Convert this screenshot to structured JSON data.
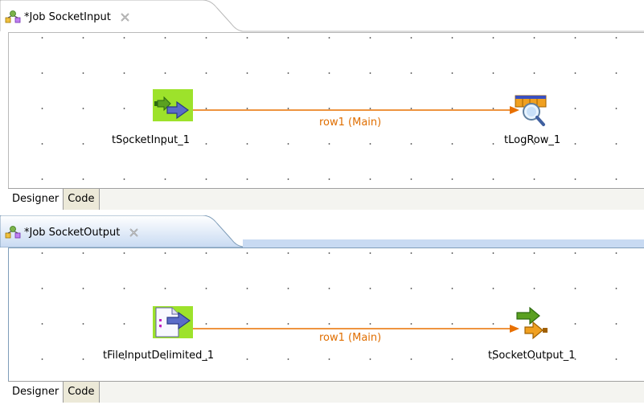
{
  "jobs": [
    {
      "tab_title": "*Job SocketInput",
      "subtabs": [
        "Designer",
        "Code"
      ],
      "source": {
        "label": "tSocketInput_1",
        "icon": "socket-input-icon"
      },
      "target": {
        "label": "tLogRow_1",
        "icon": "logrow-icon"
      },
      "link_label": "row1 (Main)"
    },
    {
      "tab_title": "*Job SocketOutput",
      "subtabs": [
        "Designer",
        "Code"
      ],
      "source": {
        "label": "tFileInputDelimited_1",
        "icon": "file-input-delimited-icon"
      },
      "target": {
        "label": "tSocketOutput_1",
        "icon": "socket-output-icon"
      },
      "link_label": "row1 (Main)"
    }
  ],
  "colors": {
    "link": "#e87000",
    "link_label": "#e06e00",
    "tab_active_border": "#7f9db9",
    "component_bg": "#9de22b"
  }
}
